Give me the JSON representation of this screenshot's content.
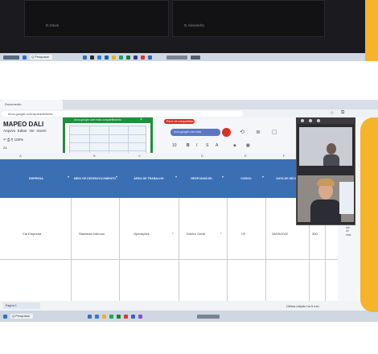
{
  "top_screenshot": {
    "tiles": [
      {
        "label": "D.Gavin"
      },
      {
        "label": "D.Alexandra"
      }
    ],
    "taskbar": {
      "search_label": "Q Pesquisar"
    }
  },
  "browser": {
    "tabs": [
      {
        "label": "Documento"
      }
    ],
    "url": "docs.google.com/spreadsheets",
    "doc_title": "MAPEO DALI",
    "menu": [
      "Arquivo",
      "Editar",
      "Ver",
      "Inserir"
    ],
    "zoom": "100%",
    "cell_ref": "A1",
    "popup": {
      "title": "docs.google.com está compartilhando"
    },
    "share_stop_label": "Parar de compartilhar",
    "share_hint": "docs.google.com está compartilhando sua tela"
  },
  "sheet": {
    "column_letters": [
      "A",
      "B",
      "C",
      "D",
      "E",
      "F",
      "G",
      "H",
      "I"
    ],
    "headers": [
      "EMPRESA",
      "MEIO DE DESENVOLVIMENTO",
      "ÁREA DE TRABALHO",
      "RESPONSÁVEL",
      "CARGO",
      "DATA DE INÍCIO",
      "",
      "",
      ""
    ],
    "rows": [
      [
        "Cia Empresa",
        "Sistemas Internos",
        "Operações",
        "Diretor Geral",
        "CF",
        "28/09/2022",
        "300",
        "",
        ""
      ]
    ],
    "side_text": [
      "Em",
      "até",
      "de",
      "dias"
    ],
    "sheet_tab": "Página 1",
    "status": "Última edição há 5 min"
  },
  "colors": {
    "header_blue": "#3b6fb3",
    "accent_yellow": "#f5b42a",
    "popup_green": "#1f8f3a",
    "stop_red": "#d93025"
  }
}
